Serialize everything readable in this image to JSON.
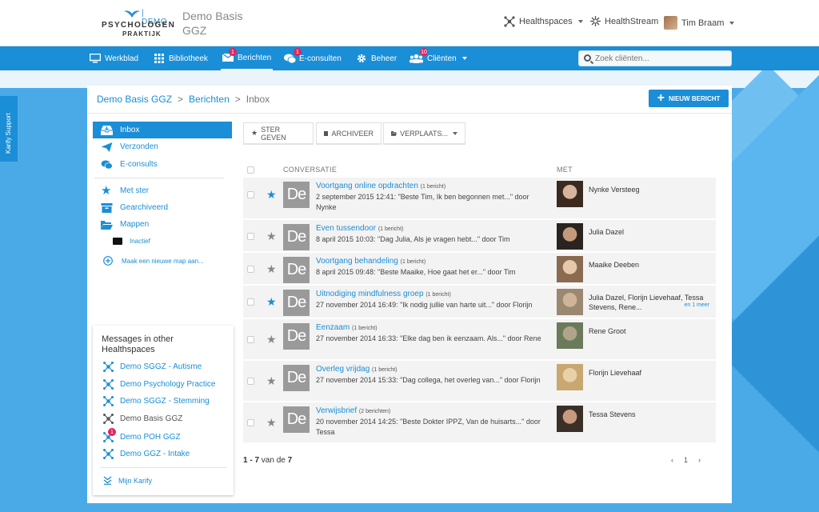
{
  "header": {
    "logo_demo": "| DEMO",
    "logo_line1": "PSYCHOLOGEN",
    "logo_line2": "PRAKTIJK",
    "org_name": "Demo Basis GGZ",
    "healthspaces_label": "Healthspaces",
    "healthstream_label": "HealthStream",
    "user_name": "Tim Braam"
  },
  "nav": {
    "items": [
      {
        "label": "Werkblad",
        "icon": "monitor-icon"
      },
      {
        "label": "Bibliotheek",
        "icon": "grid-icon"
      },
      {
        "label": "Berichten",
        "icon": "envelope-icon",
        "badge": "1",
        "active": true
      },
      {
        "label": "E-consulten",
        "icon": "chat-bubbles-icon",
        "badge": "1"
      },
      {
        "label": "Beheer",
        "icon": "gear-icon"
      },
      {
        "label": "Cliënten",
        "icon": "users-icon",
        "badge": "10"
      }
    ],
    "search_placeholder": "Zoek cliënten..."
  },
  "karify_support": "Karify Support",
  "breadcrumb": {
    "org": "Demo Basis GGZ",
    "sep1": ">",
    "messages": "Berichten",
    "sep2": ">",
    "current": "Inbox"
  },
  "new_message_button": "NIEUW BERICHT",
  "sidebar": {
    "items": [
      {
        "label": "Inbox",
        "icon": "inbox-icon"
      },
      {
        "label": "Verzonden",
        "icon": "paper-plane-icon"
      },
      {
        "label": "E-consults",
        "icon": "chat-bubbles-icon"
      },
      {
        "label": "Met ster",
        "icon": "star-icon"
      },
      {
        "label": "Gearchiveerd",
        "icon": "archive-icon"
      },
      {
        "label": "Mappen",
        "icon": "folder-open-icon"
      }
    ],
    "subfolder": "Inactief",
    "new_folder": "Maak een nieuwe map aan..."
  },
  "other_healthspaces": {
    "title": "Messages in other Healthspaces",
    "items": [
      {
        "label": "Demo SGGZ - Autisme"
      },
      {
        "label": "Demo Psychology Practice"
      },
      {
        "label": "Demo SGGZ - Stemming"
      },
      {
        "label": "Demo Basis GGZ"
      },
      {
        "label": "Demo POH GGZ",
        "badge": "1"
      },
      {
        "label": "Demo GGZ - Intake"
      }
    ],
    "my_karify": "Mijn Karify"
  },
  "toolbar": {
    "star": "STER GEVEN",
    "archive": "ARCHIVEER",
    "move": "VERPLAATS..."
  },
  "table": {
    "col_conversation": "CONVERSATIE",
    "col_with": "MET",
    "rows": [
      {
        "thumb": "De",
        "subject": "Voortgang online opdrachten",
        "count": "(1 bericht)",
        "preview": "2 september 2015 12:41: \"Beste Tim, Ik ben begonnen met...\" door Nynke",
        "with": "Nynke Versteeg",
        "more": "",
        "starred": true
      },
      {
        "thumb": "De",
        "subject": "Even tussendoor",
        "count": "(1 bericht)",
        "preview": "8 april 2015 10:03: \"Dag Julia, Als je vragen hebt...\" door Tim",
        "with": "Julia Dazel",
        "more": "",
        "starred": false
      },
      {
        "thumb": "De",
        "subject": "Voortgang behandeling",
        "count": "(1 bericht)",
        "preview": "8 april 2015 09:48: \"Beste Maaike, Hoe gaat het er...\" door Tim",
        "with": "Maaike Deeben",
        "more": "",
        "starred": false
      },
      {
        "thumb": "De",
        "subject": "Uitnodiging mindfulness groep",
        "count": "(1 bericht)",
        "preview": "27 november 2014 16:49: \"Ik nodig jullie van harte uit...\" door Florijn",
        "with": "Julia Dazel, Florijn Lievehaaf, Tessa Stevens, Rene...",
        "more": "en 1 meer",
        "starred": true
      },
      {
        "thumb": "De",
        "subject": "Eenzaam",
        "count": "(1 bericht)",
        "preview": "27 november 2014 16:33: \"Elke dag ben ik eenzaam. Als...\" door Rene",
        "with": "Rene Groot",
        "more": "",
        "starred": false
      },
      {
        "thumb": "De",
        "subject": "Overleg vrijdag",
        "count": "(1 bericht)",
        "preview": "27 november 2014 15:33: \"Dag collega, het overleg van...\" door Florijn",
        "with": "Florijn Lievehaaf",
        "more": "",
        "starred": false
      },
      {
        "thumb": "De",
        "subject": "Verwijsbrief",
        "count": "(2 berichten)",
        "preview": "20 november 2014 14:25: \"Beste Dokter IPPZ, Van de huisarts...\" door Tessa",
        "with": "Tessa Stevens",
        "more": "",
        "starred": false
      }
    ]
  },
  "pager": {
    "range": "1 - 7",
    "of": "van de",
    "total": "7",
    "page": "1"
  },
  "colors": {
    "brand_blue": "#1a8ed6",
    "badge_red": "#e0245e",
    "row_bg": "#f3f3f3"
  }
}
